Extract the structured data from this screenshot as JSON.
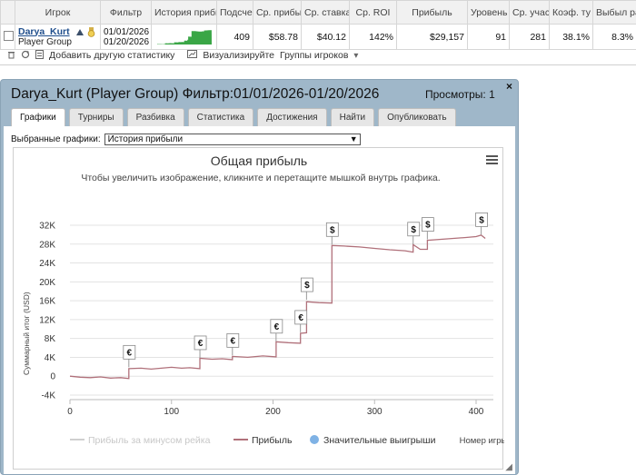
{
  "stats_table": {
    "headers": [
      "Игрок",
      "Фильтр",
      "История прибы",
      "Подсче",
      "Ср. прибы",
      "Ср. ставка",
      "Ср. ROI",
      "Прибыль",
      "Уровень",
      "Ср. учас",
      "Коэф. ту",
      "Выбыл ра"
    ],
    "row": {
      "player_name": "Darya_Kurt",
      "player_group": "Player Group",
      "filter_from": "01/01/2026",
      "filter_to": "01/20/2026",
      "count": "409",
      "avg_profit": "$58.78",
      "avg_stake": "$40.12",
      "avg_roi": "142%",
      "profit": "$29,157",
      "level": "91",
      "avg_participants": "281",
      "itm_ratio": "38.1%",
      "early_out": "8.3%"
    },
    "sparkline_color": "#3aa646"
  },
  "toolbar": {
    "add_stat_label": "Добавить другую статистику",
    "visualize_label": "Визуализируйте",
    "player_groups_label": "Группы игроков"
  },
  "dialog": {
    "title": "Darya_Kurt (Player Group) Фильтр:01/01/2026-01/20/2026",
    "views": "Просмотры: 1",
    "close_glyph": "×",
    "tabs": [
      {
        "label": "Графики",
        "active": true
      },
      {
        "label": "Турниры"
      },
      {
        "label": "Разбивка"
      },
      {
        "label": "Статистика"
      },
      {
        "label": "Достижения"
      },
      {
        "label": "Найти"
      },
      {
        "label": "Опубликовать"
      }
    ],
    "selected_charts_label": "Выбранные графики:",
    "selected_chart_value": "История прибыли"
  },
  "chart_data": {
    "type": "line",
    "title": "Общая прибыль",
    "subtitle": "Чтобы увеличить изображение, кликните и перетащите мышкой внутрь графика.",
    "ylabel": "Суммарный итог (USD)",
    "xlabel": "Номер игры",
    "xlim": [
      0,
      415
    ],
    "ylim": [
      -4000,
      32000
    ],
    "x_ticks": [
      0,
      100,
      200,
      300,
      400
    ],
    "y_ticks": [
      -4000,
      0,
      4000,
      8000,
      12000,
      16000,
      20000,
      24000,
      28000,
      32000
    ],
    "y_tick_labels": [
      "-4K",
      "0",
      "4K",
      "8K",
      "12K",
      "16K",
      "20K",
      "24K",
      "28K",
      "32K"
    ],
    "grid": true,
    "legend": [
      "Прибыль за минусом рейка",
      "Прибыль",
      "Значительные выигрыши"
    ],
    "legend_position": "bottom",
    "series": [
      {
        "name": "Прибыль",
        "color": "#b0707a",
        "points": [
          [
            0,
            0
          ],
          [
            10,
            -200
          ],
          [
            20,
            -300
          ],
          [
            30,
            -150
          ],
          [
            40,
            -400
          ],
          [
            50,
            -300
          ],
          [
            58,
            -500
          ],
          [
            58,
            1600
          ],
          [
            70,
            1700
          ],
          [
            80,
            1500
          ],
          [
            90,
            1700
          ],
          [
            100,
            1900
          ],
          [
            110,
            1700
          ],
          [
            118,
            1800
          ],
          [
            128,
            1600
          ],
          [
            128,
            3800
          ],
          [
            140,
            3600
          ],
          [
            150,
            3700
          ],
          [
            160,
            3500
          ],
          [
            160,
            4200
          ],
          [
            175,
            4000
          ],
          [
            190,
            4300
          ],
          [
            203,
            4100
          ],
          [
            203,
            7300
          ],
          [
            215,
            7100
          ],
          [
            227,
            7000
          ],
          [
            227,
            9100
          ],
          [
            233,
            9200
          ],
          [
            233,
            15800
          ],
          [
            245,
            15600
          ],
          [
            258,
            15500
          ],
          [
            258,
            27700
          ],
          [
            270,
            27600
          ],
          [
            285,
            27400
          ],
          [
            300,
            27100
          ],
          [
            315,
            26800
          ],
          [
            330,
            26600
          ],
          [
            338,
            26300
          ],
          [
            338,
            27900
          ],
          [
            345,
            26900
          ],
          [
            352,
            26900
          ],
          [
            352,
            28800
          ],
          [
            370,
            29100
          ],
          [
            390,
            29400
          ],
          [
            400,
            29600
          ],
          [
            405,
            29900
          ],
          [
            409,
            29200
          ]
        ]
      }
    ],
    "big_wins": [
      [
        58,
        1900
      ],
      [
        128,
        3900
      ],
      [
        160,
        4400
      ],
      [
        203,
        7400
      ],
      [
        227,
        9300
      ],
      [
        233,
        16200
      ],
      [
        258,
        27900
      ],
      [
        338,
        28000
      ],
      [
        352,
        29000
      ],
      [
        405,
        30000
      ]
    ],
    "big_win_glyph": "$",
    "big_win_glyph_euro": "€",
    "colors": {
      "profit": "#b0707a",
      "rake": "#cfcfcf",
      "big_win": "#7fb2e5",
      "grid": "#e3e3e3"
    }
  }
}
